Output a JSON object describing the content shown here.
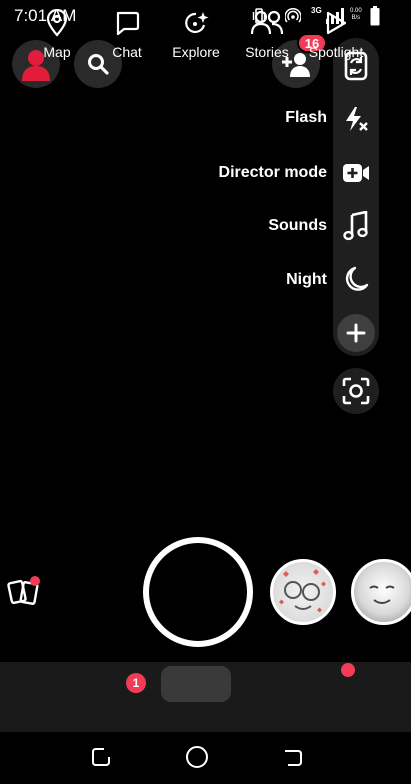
{
  "status": {
    "time": "7:01 AM",
    "network_type": "3G",
    "speed_value": "0.00",
    "speed_unit": "B/s"
  },
  "top": {
    "friend_request_count": "16"
  },
  "camera_tools": [
    {
      "label": "Flash",
      "icon": "flash-off-icon"
    },
    {
      "label": "Director mode",
      "icon": "director-mode-icon"
    },
    {
      "label": "Sounds",
      "icon": "music-note-icon"
    },
    {
      "label": "Night",
      "icon": "moon-icon"
    }
  ],
  "nav": {
    "map": "Map",
    "chat": "Chat",
    "chat_badge": "1",
    "explore": "Explore",
    "stories": "Stories",
    "spotlight": "Spotlight"
  },
  "colors": {
    "accent_red": "#f23c57",
    "background": "#000000",
    "nav_background": "#1a1a1a"
  }
}
